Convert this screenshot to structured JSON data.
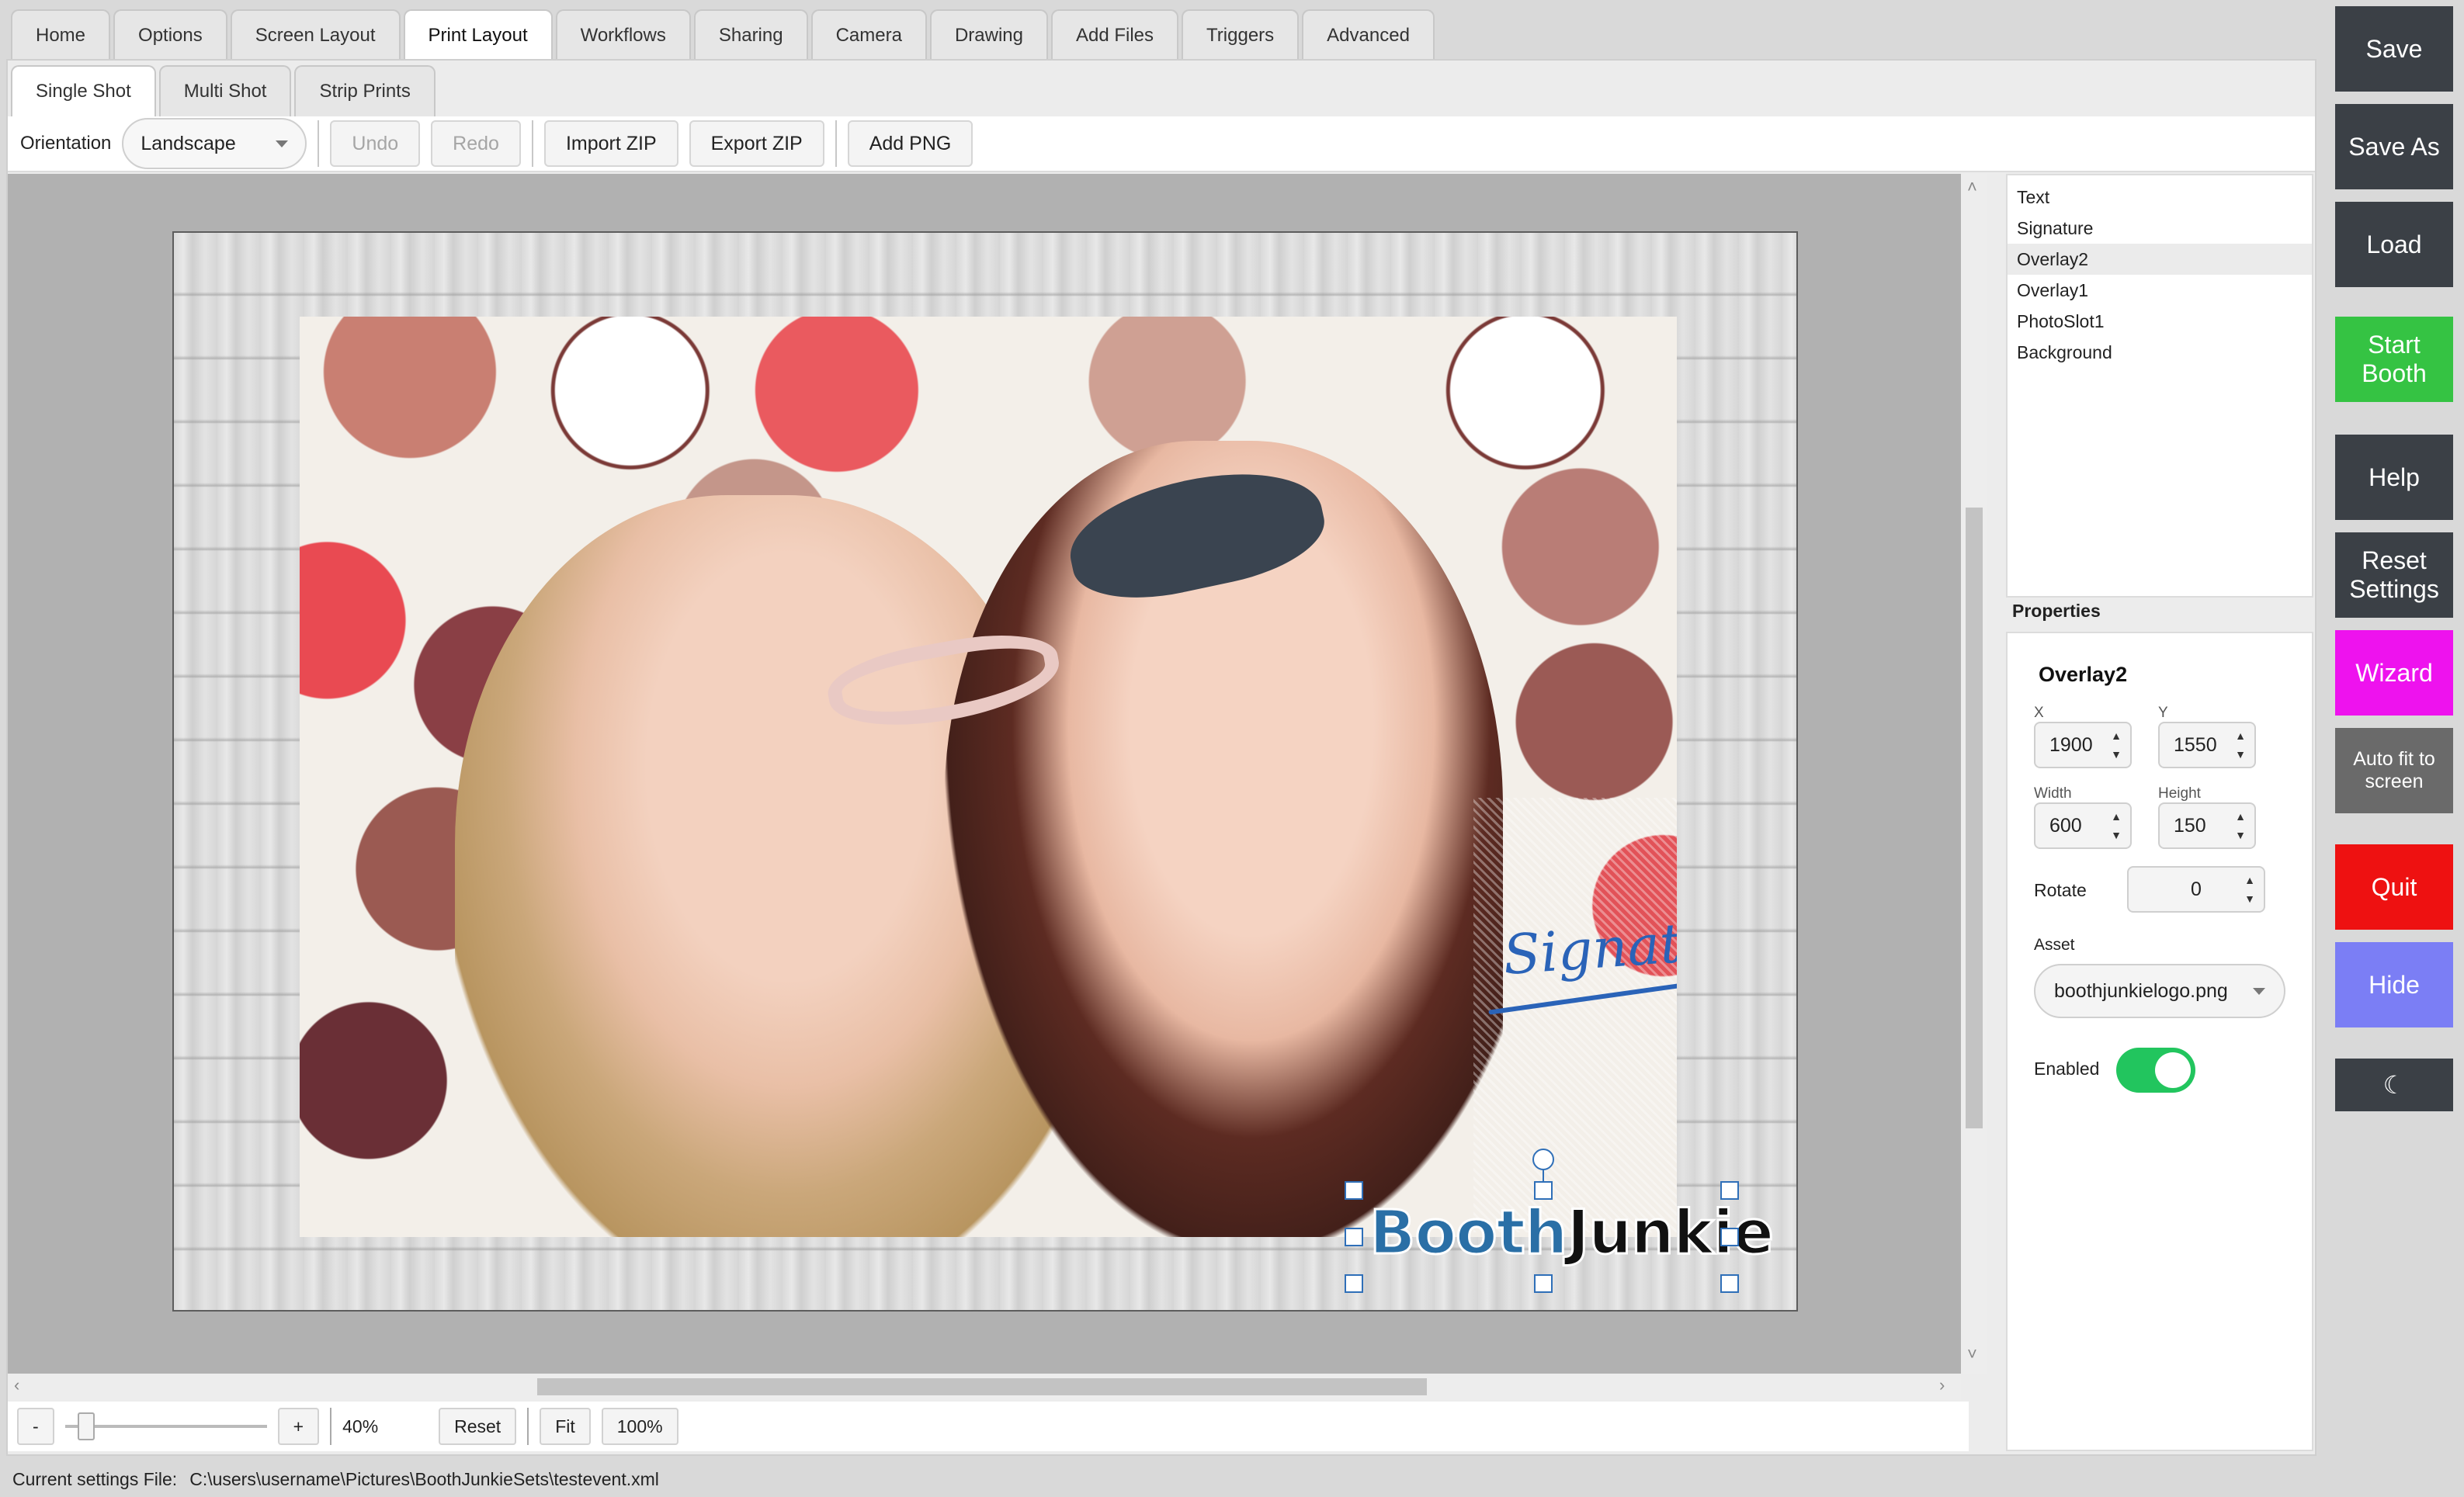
{
  "main_tabs": [
    "Home",
    "Options",
    "Screen Layout",
    "Print Layout",
    "Workflows",
    "Sharing",
    "Camera",
    "Drawing",
    "Add Files",
    "Triggers",
    "Advanced"
  ],
  "active_main_tab": "Print Layout",
  "sub_tabs": [
    "Single Shot",
    "Multi Shot",
    "Strip Prints"
  ],
  "active_sub_tab": "Single Shot",
  "toolbar": {
    "orientation_label": "Orientation",
    "orientation_value": "Landscape",
    "undo": "Undo",
    "redo": "Redo",
    "import_zip": "Import ZIP",
    "export_zip": "Export ZIP",
    "add_png": "Add PNG"
  },
  "canvas": {
    "signature_text": "Signature",
    "logo_part1": "Booth",
    "logo_part2": "Junkie"
  },
  "zoom": {
    "minus": "-",
    "plus": "+",
    "value": "40%",
    "reset": "Reset",
    "fit": "Fit",
    "hundred": "100%"
  },
  "layers": [
    "Text",
    "Signature",
    "Overlay2",
    "Overlay1",
    "PhotoSlot1",
    "Background"
  ],
  "selected_layer": "Overlay2",
  "properties": {
    "title": "Properties",
    "name": "Overlay2",
    "x_label": "X",
    "x_value": "1900",
    "y_label": "Y",
    "y_value": "1550",
    "width_label": "Width",
    "width_value": "600",
    "height_label": "Height",
    "height_value": "150",
    "rotate_label": "Rotate",
    "rotate_value": "0",
    "asset_label": "Asset",
    "asset_value": "boothjunkielogo.png",
    "enabled_label": "Enabled",
    "enabled": true
  },
  "commands": [
    {
      "label": "Save",
      "color": "#3b4046"
    },
    {
      "label": "Save As",
      "color": "#3b4046"
    },
    {
      "label": "Load",
      "color": "#3b4046"
    },
    {
      "label": "Start Booth",
      "color": "#35c343"
    },
    {
      "label": "Help",
      "color": "#3b4046"
    },
    {
      "label": "Reset Settings",
      "color": "#3b4046"
    },
    {
      "label": "Wizard",
      "color": "#ee12ee"
    },
    {
      "label": "Auto fit to screen",
      "color": "#6a6a6a"
    },
    {
      "label": "Quit",
      "color": "#ee1111"
    },
    {
      "label": "Hide",
      "color": "#7b7ef5"
    },
    {
      "label": "☾",
      "color": "#3b4046"
    }
  ],
  "status": {
    "label": "Current settings File:",
    "path": "C:\\users\\username\\Pictures\\BoothJunkieSets\\testevent.xml"
  }
}
